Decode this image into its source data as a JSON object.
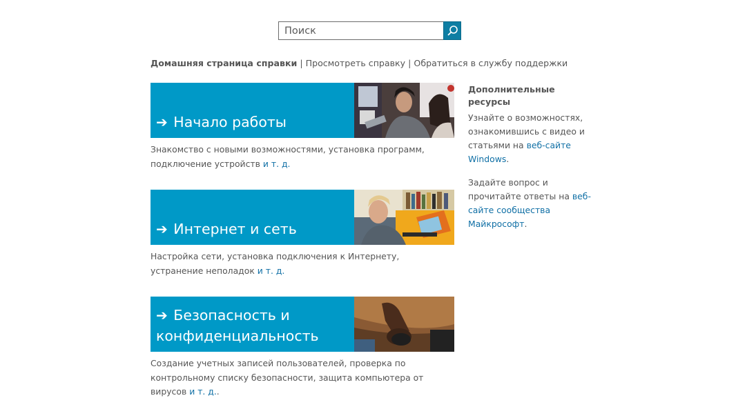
{
  "search": {
    "placeholder": "Поиск",
    "button_icon": "magnifier-icon"
  },
  "nav": {
    "current": "Домашняя страница справки",
    "separator": "|",
    "links": [
      "Просмотреть справку",
      "Обратиться в службу поддержки"
    ]
  },
  "colors": {
    "tile": "#0099c7",
    "link": "#0f6fa5",
    "search_button": "#0e7ea3"
  },
  "cards": [
    {
      "title": "Начало работы",
      "arrow": "➔",
      "desc": "Знакомство с новыми возможностями, установка программ, подключение устройств",
      "more": "и т. д.",
      "after": ""
    },
    {
      "title": "Интернет и сеть",
      "arrow": "➔",
      "desc": "Настройка сети, установка подключения к Интернету, устранение неполадок",
      "more": "и т. д.",
      "after": ""
    },
    {
      "title": "Безопасность и конфиденциальность",
      "arrow": "➔",
      "desc": "Создание учетных записей пользователей, проверка по контрольному списку безопасности, защита компьютера от вирусов",
      "more": "и т. д.",
      "after": "."
    }
  ],
  "sidebar": {
    "title": "Дополнительные ресурсы",
    "p1_text": "Узнайте о возможностях, ознакомившись с видео и статьями на",
    "p1_link": "веб-сайте Windows",
    "p1_end": ".",
    "p2_text": "Задайте вопрос и прочитайте ответы на",
    "p2_link": "веб-сайте сообщества Майкрософт",
    "p2_end": "."
  }
}
